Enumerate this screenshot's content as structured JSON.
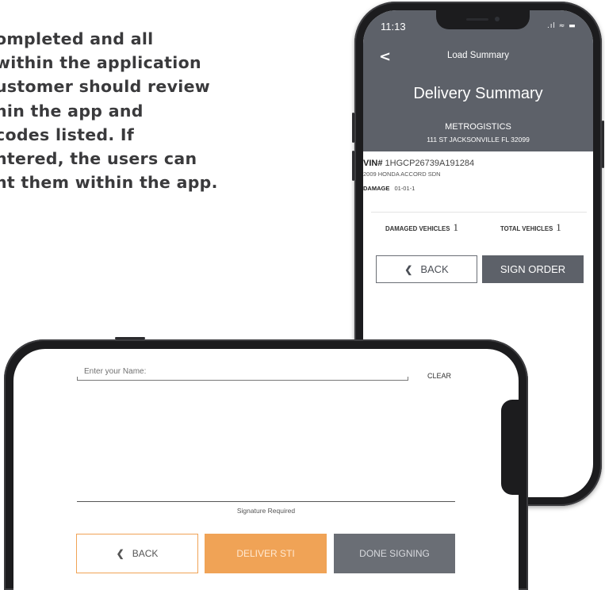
{
  "promo": {
    "lines": [
      "ompleted and all",
      " within the application",
      "ustomer should review",
      "hin the app and",
      "codes listed. If",
      "ntered, the users can",
      "nt them within the app."
    ]
  },
  "portrait": {
    "status_time": "11:13",
    "status_icons": ".ıl ≈ ▬",
    "nav_back_glyph": "<",
    "nav_title": "Load Summary",
    "header_title": "Delivery Summary",
    "company": "METROGISTICS",
    "address": "111 ST JACKSONVILLE FL 32099",
    "vin_label": "VIN#",
    "vin": "1HGCP26739A191284",
    "vehicle": "2009 HONDA ACCORD SDN",
    "damage_label": "DAMAGE",
    "damage_code": "01-01-1",
    "damaged_label": "DAMAGED VEHICLES",
    "damaged_count": "1",
    "total_label": "TOTAL VEHICLES",
    "total_count": "1",
    "back_label": "BACK",
    "sign_label": "SIGN ORDER"
  },
  "landscape": {
    "name_placeholder": "Enter your Name:",
    "clear_label": "CLEAR",
    "signature_label": "Signature Required",
    "back_label": "BACK",
    "deliver_label": "DELIVER STI",
    "done_label": "DONE SIGNING"
  },
  "colors": {
    "header_gray": "#5d6169",
    "accent_orange": "#f0a356",
    "button_gray": "#6a6e75"
  },
  "icons": {
    "back": "chevron-left-icon",
    "signal": "signal-icon",
    "wifi": "wifi-icon",
    "battery": "battery-icon"
  }
}
